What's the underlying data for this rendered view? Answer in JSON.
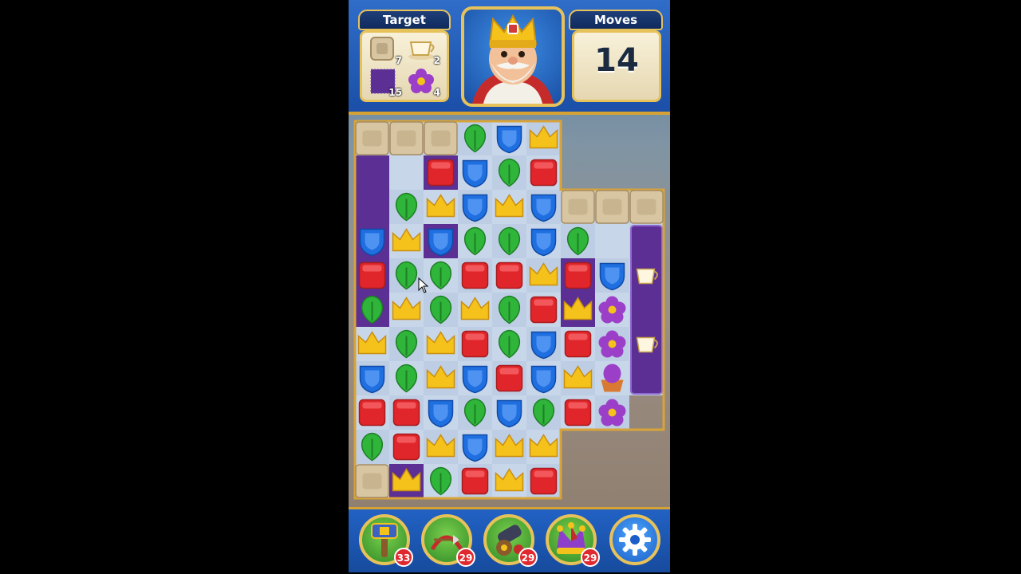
{
  "header": {
    "target_label": "Target",
    "moves_label": "Moves",
    "moves_value": "14",
    "targets": [
      {
        "icon": "stone-block-icon",
        "count": "7"
      },
      {
        "icon": "teacup-icon",
        "count": "2"
      },
      {
        "icon": "purple-carpet-icon",
        "count": "15"
      },
      {
        "icon": "purple-flower-icon",
        "count": "4"
      }
    ],
    "avatar_icon": "king-avatar-icon"
  },
  "board": {
    "rows": [
      [
        "stone",
        "stone",
        "stone",
        "leaf",
        "shield",
        "crown",
        "",
        "",
        ""
      ],
      [
        "",
        "",
        "cube",
        "shield",
        "leaf",
        "cube",
        "",
        "",
        ""
      ],
      [
        "",
        "leaf",
        "crown",
        "shield",
        "crown",
        "shield",
        "stone",
        "stone",
        "stone"
      ],
      [
        "shield",
        "crown",
        "shield",
        "leaf",
        "leaf",
        "shield",
        "leaf",
        "",
        ""
      ],
      [
        "cube",
        "leaf",
        "leaf",
        "cube",
        "cube",
        "crown",
        "cube",
        "shield",
        "teacup"
      ],
      [
        "leaf",
        "crown",
        "leaf",
        "crown",
        "leaf",
        "cube",
        "crown",
        "flower",
        ""
      ],
      [
        "crown",
        "leaf",
        "crown",
        "cube",
        "leaf",
        "shield",
        "cube",
        "flower",
        "teacup"
      ],
      [
        "shield",
        "leaf",
        "crown",
        "shield",
        "cube",
        "shield",
        "crown",
        "flowerpot",
        ""
      ],
      [
        "cube",
        "cube",
        "shield",
        "leaf",
        "shield",
        "leaf",
        "cube",
        "flower",
        ""
      ],
      [
        "leaf",
        "cube",
        "crown",
        "shield",
        "crown",
        "crown",
        "",
        "",
        ""
      ],
      [
        "stone",
        "crown",
        "leaf",
        "cube",
        "crown",
        "cube",
        "",
        "",
        ""
      ]
    ],
    "purple_cells": [
      [
        1,
        0
      ],
      [
        2,
        0
      ],
      [
        3,
        0
      ],
      [
        4,
        0
      ],
      [
        5,
        0
      ],
      [
        1,
        2
      ],
      [
        3,
        2
      ],
      [
        4,
        6
      ],
      [
        5,
        6
      ],
      [
        10,
        1
      ]
    ],
    "colors": {
      "leaf": "#2fb53a",
      "shield": "#1f6fe0",
      "crown": "#f4c21a",
      "cube": "#e0262a",
      "stone": "#d8c6a3",
      "flower": "#9b3fc9",
      "purple": "#5b2f93",
      "gold": "#d8a33a"
    }
  },
  "boosters": [
    {
      "icon": "hammer-icon",
      "count": "33"
    },
    {
      "icon": "arrow-icon",
      "count": "29"
    },
    {
      "icon": "cannon-icon",
      "count": "29"
    },
    {
      "icon": "jester-hat-icon",
      "count": "29"
    }
  ],
  "settings_icon": "gear-icon"
}
